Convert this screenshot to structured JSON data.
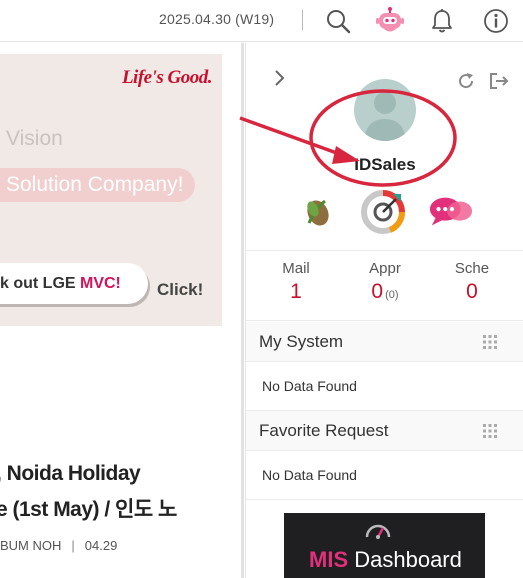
{
  "topbar": {
    "date": "2025.04.30 (W19)",
    "icons": [
      "search-icon",
      "chatbot-icon",
      "bell-icon",
      "info-icon"
    ]
  },
  "banner": {
    "brand": "Life's Good.",
    "vision": "Vision",
    "solution": "Solution Company!",
    "pill_prefix": "k out LGE ",
    "pill_accent": "MVC!",
    "click": "Click!"
  },
  "news": {
    "title_line1": ", Noida Holiday",
    "title_line2": "e (1st May) / 인도 노",
    "author": "BUM NOH",
    "date": "04.29"
  },
  "profile": {
    "username": "IDSales",
    "apps": [
      "app-leaf-icon",
      "app-dashboard-icon",
      "app-chat-icon"
    ]
  },
  "stats": [
    {
      "label": "Mail",
      "value": "1",
      "extra": ""
    },
    {
      "label": "Appr",
      "value": "0",
      "extra": "(0)"
    },
    {
      "label": "Sche",
      "value": "0",
      "extra": ""
    }
  ],
  "my_system": {
    "title": "My System",
    "empty": "No Data Found"
  },
  "favorite": {
    "title": "Favorite Request",
    "empty": "No Data Found"
  },
  "mis": {
    "accent": "MIS",
    "rest": " Dashboard"
  },
  "colors": {
    "brand_red": "#c8102e",
    "annotation_red": "#d7263d",
    "accent_pink": "#e0317a"
  }
}
